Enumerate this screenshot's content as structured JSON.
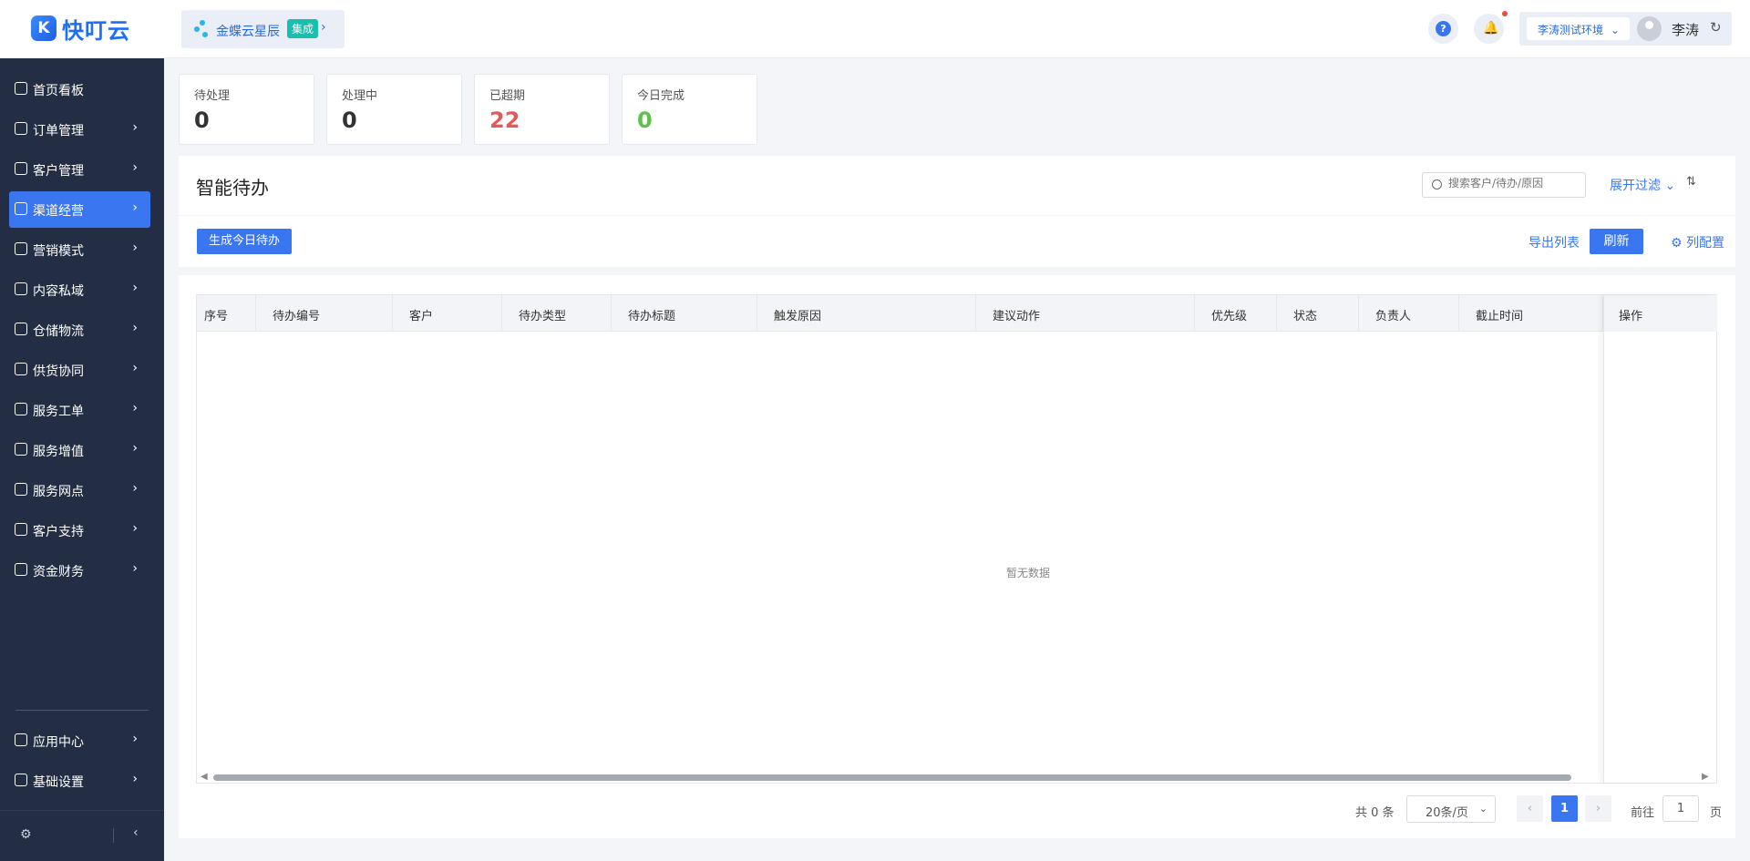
{
  "app": {
    "logo_text": "快叮云",
    "logo_mark": "K"
  },
  "sidebar": {
    "items": [
      {
        "label": "首页看板",
        "icon": "home-icon",
        "has_arrow": false
      },
      {
        "label": "订单管理",
        "icon": "order-icon",
        "has_arrow": true
      },
      {
        "label": "客户管理",
        "icon": "user-icon",
        "has_arrow": true
      },
      {
        "label": "渠道经营",
        "icon": "channel-icon",
        "has_arrow": true,
        "active": true
      },
      {
        "label": "营销模式",
        "icon": "tag-icon",
        "has_arrow": true
      },
      {
        "label": "内容私域",
        "icon": "image-icon",
        "has_arrow": true
      },
      {
        "label": "仓储物流",
        "icon": "warehouse-icon",
        "has_arrow": true
      },
      {
        "label": "供货协同",
        "icon": "supply-icon",
        "has_arrow": true
      },
      {
        "label": "服务工单",
        "icon": "ticket-icon",
        "has_arrow": true
      },
      {
        "label": "服务增值",
        "icon": "bag-icon",
        "has_arrow": true
      },
      {
        "label": "服务网点",
        "icon": "store-icon",
        "has_arrow": true
      },
      {
        "label": "客户支持",
        "icon": "support-icon",
        "has_arrow": true
      },
      {
        "label": "资金财务",
        "icon": "yuan-icon",
        "has_arrow": true
      }
    ],
    "bottom_items": [
      {
        "label": "应用中心",
        "icon": "cube-icon",
        "has_arrow": true
      },
      {
        "label": "基础设置",
        "icon": "settings-list-icon",
        "has_arrow": true
      }
    ]
  },
  "header": {
    "integration_name": "金蝶云星辰",
    "integration_tag": "集成",
    "environment": "李涛测试环境",
    "user_name": "李涛"
  },
  "stats": [
    {
      "label": "待处理",
      "value": "0",
      "color": "#333333"
    },
    {
      "label": "处理中",
      "value": "0",
      "color": "#333333"
    },
    {
      "label": "已超期",
      "value": "22",
      "color": "#e25b5b"
    },
    {
      "label": "今日完成",
      "value": "0",
      "color": "#5ec24a"
    }
  ],
  "page": {
    "title": "智能待办",
    "search_placeholder": "搜索客户/待办/原因",
    "expand_filter": "展开过滤",
    "generate_button": "生成今日待办",
    "export_button": "导出列表",
    "refresh_button": "刷新",
    "column_config": "列配置"
  },
  "table": {
    "columns": [
      "序号",
      "待办编号",
      "客户",
      "待办类型",
      "待办标题",
      "触发原因",
      "建议动作",
      "优先级",
      "状态",
      "负责人",
      "截止时间"
    ],
    "fixed_column": "操作",
    "empty_text": "暂无数据"
  },
  "pagination": {
    "total": "共 0 条",
    "page_size": "20条/页",
    "current_page": "1",
    "goto_label": "前往",
    "goto_value": "1",
    "page_label": "页"
  }
}
